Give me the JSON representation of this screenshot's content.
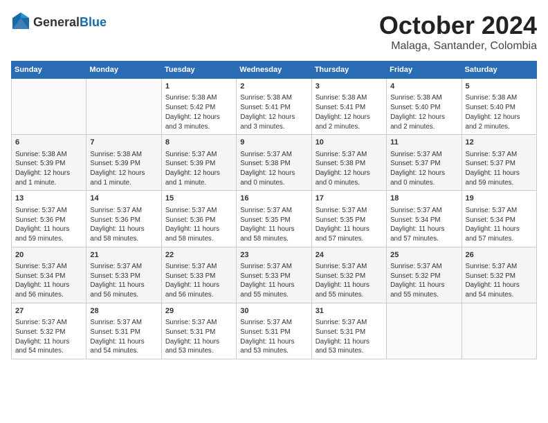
{
  "logo": {
    "general": "General",
    "blue": "Blue"
  },
  "header": {
    "month": "October 2024",
    "location": "Malaga, Santander, Colombia"
  },
  "weekdays": [
    "Sunday",
    "Monday",
    "Tuesday",
    "Wednesday",
    "Thursday",
    "Friday",
    "Saturday"
  ],
  "weeks": [
    [
      {
        "day": "",
        "info": ""
      },
      {
        "day": "",
        "info": ""
      },
      {
        "day": "1",
        "info": "Sunrise: 5:38 AM\nSunset: 5:42 PM\nDaylight: 12 hours\nand 3 minutes."
      },
      {
        "day": "2",
        "info": "Sunrise: 5:38 AM\nSunset: 5:41 PM\nDaylight: 12 hours\nand 3 minutes."
      },
      {
        "day": "3",
        "info": "Sunrise: 5:38 AM\nSunset: 5:41 PM\nDaylight: 12 hours\nand 2 minutes."
      },
      {
        "day": "4",
        "info": "Sunrise: 5:38 AM\nSunset: 5:40 PM\nDaylight: 12 hours\nand 2 minutes."
      },
      {
        "day": "5",
        "info": "Sunrise: 5:38 AM\nSunset: 5:40 PM\nDaylight: 12 hours\nand 2 minutes."
      }
    ],
    [
      {
        "day": "6",
        "info": "Sunrise: 5:38 AM\nSunset: 5:39 PM\nDaylight: 12 hours\nand 1 minute."
      },
      {
        "day": "7",
        "info": "Sunrise: 5:38 AM\nSunset: 5:39 PM\nDaylight: 12 hours\nand 1 minute."
      },
      {
        "day": "8",
        "info": "Sunrise: 5:37 AM\nSunset: 5:39 PM\nDaylight: 12 hours\nand 1 minute."
      },
      {
        "day": "9",
        "info": "Sunrise: 5:37 AM\nSunset: 5:38 PM\nDaylight: 12 hours\nand 0 minutes."
      },
      {
        "day": "10",
        "info": "Sunrise: 5:37 AM\nSunset: 5:38 PM\nDaylight: 12 hours\nand 0 minutes."
      },
      {
        "day": "11",
        "info": "Sunrise: 5:37 AM\nSunset: 5:37 PM\nDaylight: 12 hours\nand 0 minutes."
      },
      {
        "day": "12",
        "info": "Sunrise: 5:37 AM\nSunset: 5:37 PM\nDaylight: 11 hours\nand 59 minutes."
      }
    ],
    [
      {
        "day": "13",
        "info": "Sunrise: 5:37 AM\nSunset: 5:36 PM\nDaylight: 11 hours\nand 59 minutes."
      },
      {
        "day": "14",
        "info": "Sunrise: 5:37 AM\nSunset: 5:36 PM\nDaylight: 11 hours\nand 58 minutes."
      },
      {
        "day": "15",
        "info": "Sunrise: 5:37 AM\nSunset: 5:36 PM\nDaylight: 11 hours\nand 58 minutes."
      },
      {
        "day": "16",
        "info": "Sunrise: 5:37 AM\nSunset: 5:35 PM\nDaylight: 11 hours\nand 58 minutes."
      },
      {
        "day": "17",
        "info": "Sunrise: 5:37 AM\nSunset: 5:35 PM\nDaylight: 11 hours\nand 57 minutes."
      },
      {
        "day": "18",
        "info": "Sunrise: 5:37 AM\nSunset: 5:34 PM\nDaylight: 11 hours\nand 57 minutes."
      },
      {
        "day": "19",
        "info": "Sunrise: 5:37 AM\nSunset: 5:34 PM\nDaylight: 11 hours\nand 57 minutes."
      }
    ],
    [
      {
        "day": "20",
        "info": "Sunrise: 5:37 AM\nSunset: 5:34 PM\nDaylight: 11 hours\nand 56 minutes."
      },
      {
        "day": "21",
        "info": "Sunrise: 5:37 AM\nSunset: 5:33 PM\nDaylight: 11 hours\nand 56 minutes."
      },
      {
        "day": "22",
        "info": "Sunrise: 5:37 AM\nSunset: 5:33 PM\nDaylight: 11 hours\nand 56 minutes."
      },
      {
        "day": "23",
        "info": "Sunrise: 5:37 AM\nSunset: 5:33 PM\nDaylight: 11 hours\nand 55 minutes."
      },
      {
        "day": "24",
        "info": "Sunrise: 5:37 AM\nSunset: 5:32 PM\nDaylight: 11 hours\nand 55 minutes."
      },
      {
        "day": "25",
        "info": "Sunrise: 5:37 AM\nSunset: 5:32 PM\nDaylight: 11 hours\nand 55 minutes."
      },
      {
        "day": "26",
        "info": "Sunrise: 5:37 AM\nSunset: 5:32 PM\nDaylight: 11 hours\nand 54 minutes."
      }
    ],
    [
      {
        "day": "27",
        "info": "Sunrise: 5:37 AM\nSunset: 5:32 PM\nDaylight: 11 hours\nand 54 minutes."
      },
      {
        "day": "28",
        "info": "Sunrise: 5:37 AM\nSunset: 5:31 PM\nDaylight: 11 hours\nand 54 minutes."
      },
      {
        "day": "29",
        "info": "Sunrise: 5:37 AM\nSunset: 5:31 PM\nDaylight: 11 hours\nand 53 minutes."
      },
      {
        "day": "30",
        "info": "Sunrise: 5:37 AM\nSunset: 5:31 PM\nDaylight: 11 hours\nand 53 minutes."
      },
      {
        "day": "31",
        "info": "Sunrise: 5:37 AM\nSunset: 5:31 PM\nDaylight: 11 hours\nand 53 minutes."
      },
      {
        "day": "",
        "info": ""
      },
      {
        "day": "",
        "info": ""
      }
    ]
  ]
}
